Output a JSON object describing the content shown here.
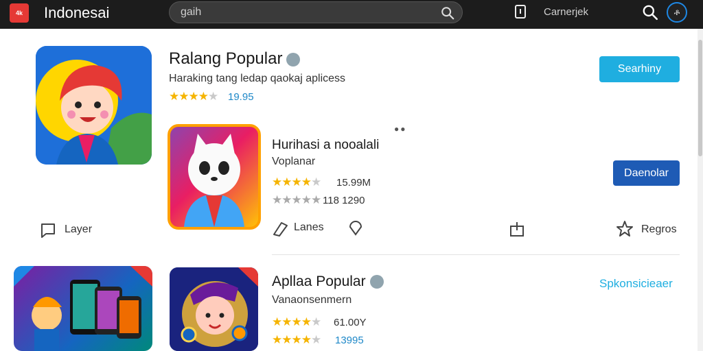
{
  "topbar": {
    "brand_logo_text": "4k",
    "brand_name": "Indonesai",
    "search_value": "gaih",
    "right_label": "Carnerjek",
    "avatar_text": "ቶ"
  },
  "sections": [
    {
      "title": "Ralang Popular",
      "subtitle": "Haraking tang ledap qaokaj aplicess",
      "rating_value": "19.95",
      "button_label": "Searhiny"
    },
    {
      "title": "Apllaa Popular",
      "subtitle": "Vanaonsenmern",
      "link_label": "Spkonsicieaer"
    }
  ],
  "apps": [
    {
      "name": "Hurihasi a nooalali",
      "developer": "Voplanar",
      "rating_value": "15.99M",
      "secondary_value": "118 1290",
      "button_label": "Daenolar"
    },
    {
      "rating_value": "61.00Y",
      "secondary_value": "13995"
    }
  ],
  "actions": {
    "layer_label": "Layer",
    "lanes_label": "Lanes",
    "reg_label": "Regros"
  },
  "colors": {
    "topbar_bg": "#1c1c1c",
    "accent_cyan": "#1faee0",
    "accent_navy": "#1e5bb5",
    "star": "#f5b400"
  },
  "icons": [
    "search-icon",
    "document-icon",
    "globe-icon",
    "chat-icon",
    "tag-icon",
    "location-icon",
    "share-icon",
    "star-icon"
  ]
}
